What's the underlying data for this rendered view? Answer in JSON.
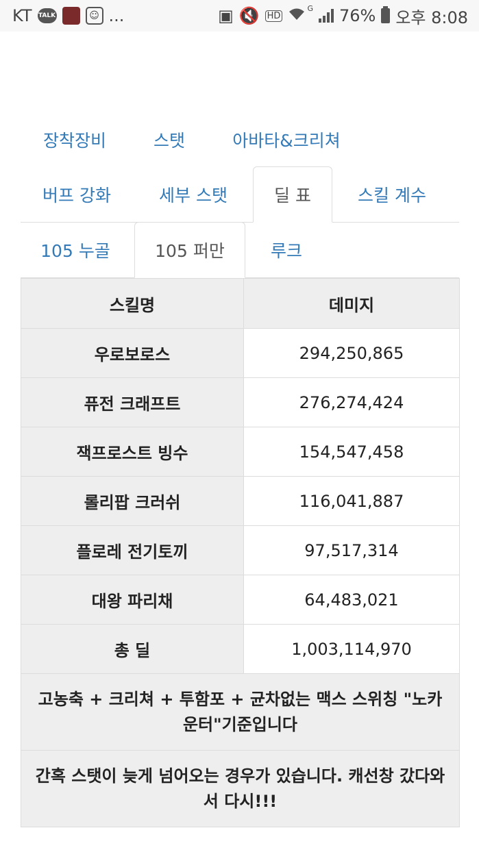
{
  "status_bar": {
    "carrier": "KT",
    "talk_label": "TALK",
    "more": "...",
    "network_label": "HD",
    "signal_label": "G",
    "battery": "76%",
    "time": "오후 8:08"
  },
  "tabs_row1": [
    "장착장비",
    "스탯",
    "아바타&크리쳐"
  ],
  "tabs_row2": [
    "버프 강화",
    "세부 스탯",
    "딜 표",
    "스킬 계수"
  ],
  "tabs_row3": [
    "105 누골",
    "105 퍼만",
    "루크"
  ],
  "active_tab_row2": "딜 표",
  "active_tab_row3": "105 퍼만",
  "table": {
    "headers": [
      "스킬명",
      "데미지"
    ],
    "rows": [
      {
        "skill": "우로보로스",
        "damage": "294,250,865"
      },
      {
        "skill": "퓨전 크래프트",
        "damage": "276,274,424"
      },
      {
        "skill": "잭프로스트 빙수",
        "damage": "154,547,458"
      },
      {
        "skill": "롤리팝 크러쉬",
        "damage": "116,041,887"
      },
      {
        "skill": "플로레 전기토끼",
        "damage": "97,517,314"
      },
      {
        "skill": "대왕 파리채",
        "damage": "64,483,021"
      },
      {
        "skill": "총 딜",
        "damage": "1,003,114,970"
      }
    ],
    "notes": [
      "고농축 + 크리쳐 + 투함포 + 균차없는 맥스 스위칭 \"노카운터\"기준입니다",
      "간혹 스탯이 늦게 넘어오는 경우가 있습니다. 캐선창 갔다와서 다시!!!"
    ]
  },
  "colors": {
    "link": "#337ab7",
    "header_bg": "#eeeeee",
    "border": "#dddddd"
  }
}
